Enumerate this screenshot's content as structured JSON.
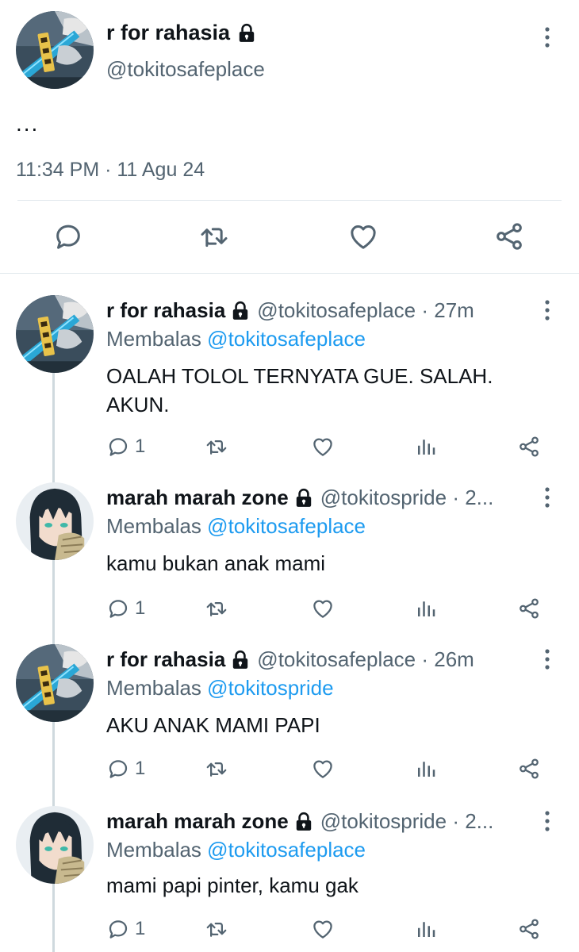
{
  "main_tweet": {
    "name": "r for rahasia",
    "handle": "@tokitosafeplace",
    "text": "...",
    "timestamp": "11:34 PM · 11 Agu 24",
    "actions": [
      "reply-icon",
      "retweet-icon",
      "like-icon",
      "share-icon"
    ]
  },
  "replies": [
    {
      "name": "r for rahasia",
      "meta": "@tokitosafeplace · 27m",
      "reply_label": "Membalas",
      "reply_to": "@tokitosafeplace",
      "text": "OALAH TOLOL TERNYATA GUE. SALAH. AKUN.",
      "reply_count": "1",
      "avatar": "sword"
    },
    {
      "name": "marah marah zone",
      "meta": "@tokitospride · 2...",
      "reply_label": "Membalas",
      "reply_to": "@tokitosafeplace",
      "text": "kamu bukan anak mami",
      "reply_count": "1",
      "avatar": "character"
    },
    {
      "name": "r for rahasia",
      "meta": "@tokitosafeplace · 26m",
      "reply_label": "Membalas",
      "reply_to": "@tokitospride",
      "text": "AKU ANAK MAMI PAPI",
      "reply_count": "1",
      "avatar": "sword"
    },
    {
      "name": "marah marah zone",
      "meta": "@tokitospride · 2...",
      "reply_label": "Membalas",
      "reply_to": "@tokitosafeplace",
      "text": "mami papi pinter, kamu gak",
      "reply_count": "1",
      "avatar": "character"
    }
  ],
  "colors": {
    "text": "#0f1419",
    "secondary": "#536471",
    "mention": "#1d9bf0",
    "divider": "#e1e8ed",
    "thread_line": "#cfd9de"
  }
}
